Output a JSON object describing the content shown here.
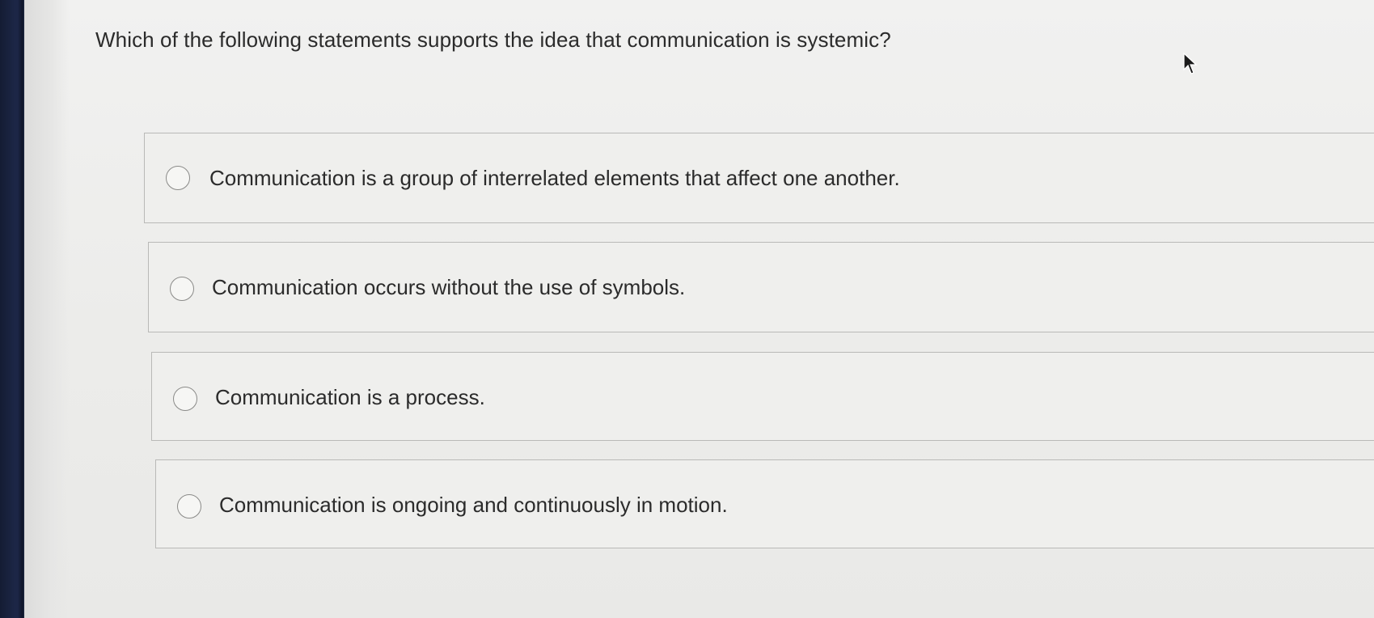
{
  "question": {
    "text": "Which of the following statements supports the idea that communication is systemic?"
  },
  "options": [
    {
      "label": "Communication is a group of interrelated elements that affect one another."
    },
    {
      "label": "Communication occurs without the use of symbols."
    },
    {
      "label": "Communication is a process."
    },
    {
      "label": "Communication is ongoing and continuously in motion."
    }
  ],
  "colors": {
    "page_background": "#ececea",
    "text": "#2b2b2b",
    "option_border": "#b9b9b7",
    "radio_border": "#8a8a88"
  },
  "icons": {
    "cursor": "arrow-cursor-icon",
    "radio": "radio-button-icon"
  }
}
